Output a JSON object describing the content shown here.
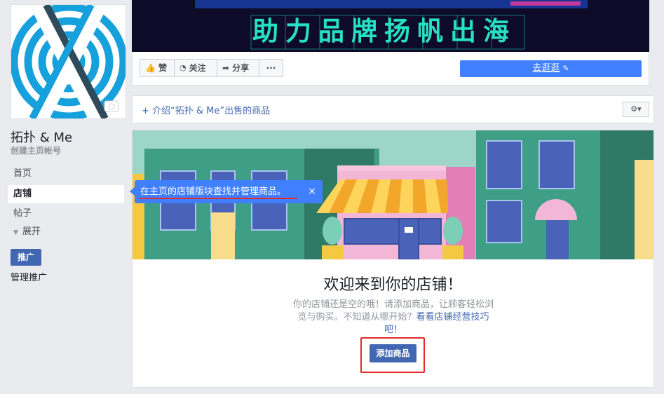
{
  "page": {
    "name": "拓扑 & Me",
    "username": "创建主页帐号"
  },
  "cover": {
    "slogan": "助力品牌扬帆出海"
  },
  "sidebar": {
    "items": [
      {
        "label": "首页"
      },
      {
        "label": "店铺"
      },
      {
        "label": "帖子"
      },
      {
        "label": "展开"
      }
    ],
    "promote_label": "推广",
    "manage_promotions": "管理推广"
  },
  "actions": {
    "like": "赞",
    "follow": "关注",
    "share": "分享",
    "more": "···",
    "visit": "去逛逛"
  },
  "intro": {
    "link": "+ 介绍“拓扑 & Me”出售的商品",
    "gear": "⚙▾"
  },
  "tooltip": {
    "text": "在主页的店铺版块查找并管理商品。",
    "close": "×"
  },
  "shop": {
    "welcome": "欢迎来到你的店铺！",
    "desc_text": "你的店铺还是空的哦！请添加商品，让顾客轻松浏览与购买。不知道从哪开始？",
    "desc_link": "看看店铺经营技巧吧！",
    "add_button": "添加商品"
  },
  "colors": {
    "brand_blue": "#4267b2",
    "accent_blue": "#4080ff",
    "highlight_red": "#e52b2b"
  }
}
